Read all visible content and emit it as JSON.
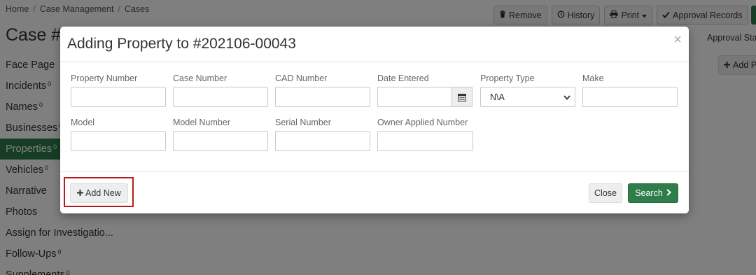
{
  "breadcrumb": [
    "Home",
    "Case Management",
    "Cases"
  ],
  "page": {
    "title": "Case #"
  },
  "toolbar": {
    "remove_label": "Remove",
    "history_label": "History",
    "print_label": "Print",
    "approval_records_label": "Approval Records"
  },
  "right_panel": {
    "approval_status_label": "Approval Sta",
    "add_label": "Add P"
  },
  "sidebar": {
    "items": [
      {
        "label": "Face Page",
        "count": ""
      },
      {
        "label": "Incidents",
        "count": "0"
      },
      {
        "label": "Names",
        "count": "0"
      },
      {
        "label": "Businesses",
        "count": "0"
      },
      {
        "label": "Properties",
        "count": "0"
      },
      {
        "label": "Vehicles",
        "count": "0"
      },
      {
        "label": "Narrative",
        "count": ""
      },
      {
        "label": "Photos",
        "count": ""
      },
      {
        "label": "Assign for Investigatio...",
        "count": ""
      },
      {
        "label": "Follow-Ups",
        "count": "0"
      },
      {
        "label": "Supplements",
        "count": "0"
      }
    ]
  },
  "modal": {
    "title": "Adding Property to #202106-00043",
    "close_glyph": "×",
    "fields": {
      "property_number": {
        "label": "Property Number",
        "value": ""
      },
      "case_number": {
        "label": "Case Number",
        "value": ""
      },
      "cad_number": {
        "label": "CAD Number",
        "value": ""
      },
      "date_entered": {
        "label": "Date Entered",
        "value": ""
      },
      "property_type": {
        "label": "Property Type",
        "value": "N\\A"
      },
      "make": {
        "label": "Make",
        "value": ""
      },
      "model": {
        "label": "Model",
        "value": ""
      },
      "model_number": {
        "label": "Model Number",
        "value": ""
      },
      "serial_number": {
        "label": "Serial Number",
        "value": ""
      },
      "owner_applied_number": {
        "label": "Owner Applied Number",
        "value": ""
      }
    },
    "footer": {
      "add_new_label": "Add New",
      "close_label": "Close",
      "search_label": "Search"
    }
  },
  "colors": {
    "accent_green": "#2e7d4a",
    "highlight_red": "#b71c1c"
  }
}
